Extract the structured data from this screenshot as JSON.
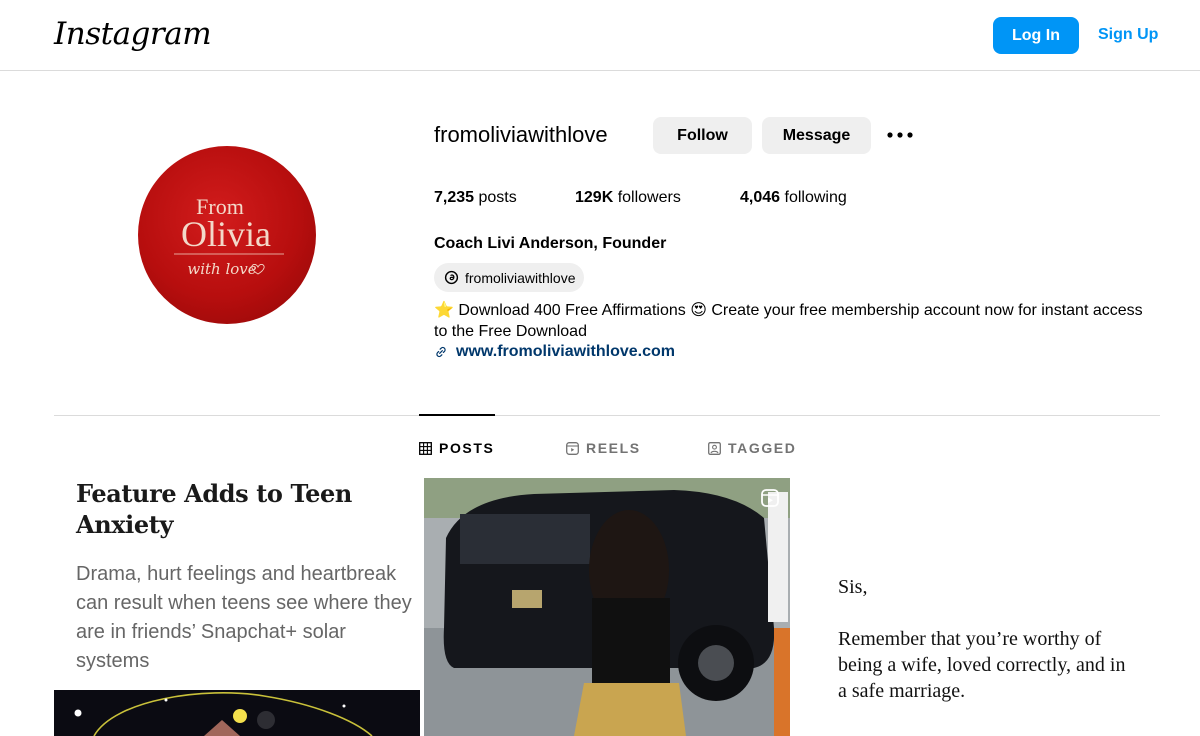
{
  "nav": {
    "logo": "Instagram",
    "login_label": "Log In",
    "signup_label": "Sign Up",
    "accent_color": "#0095f6"
  },
  "profile": {
    "avatar": {
      "line1": "From",
      "line2": "Olivia",
      "line3": "with love",
      "background_color": "#b70e0e"
    },
    "username": "fromoliviawithlove",
    "follow_label": "Follow",
    "message_label": "Message",
    "more_icon": "more-dots-icon",
    "stats": {
      "posts_count": "7,235",
      "posts_label": "posts",
      "followers_count": "129K",
      "followers_label": "followers",
      "following_count": "4,046",
      "following_label": "following"
    },
    "full_name": "Coach Livi Anderson, Founder",
    "threads_handle": "fromoliviawithlove",
    "bio": "⭐ Download 400 Free Affirmations 😍 Create your free membership account now for instant access to the Free Download",
    "website": "www.fromoliviawithlove.com"
  },
  "tabs": [
    {
      "label": "POSTS",
      "icon": "grid-icon",
      "active": true
    },
    {
      "label": "REELS",
      "icon": "reels-icon",
      "active": false
    },
    {
      "label": "TAGGED",
      "icon": "tagged-icon",
      "active": false
    }
  ],
  "posts": [
    {
      "title": "Feature Adds to Teen Anxiety",
      "body": "Drama, hurt feelings and heartbreak can result when teens see where they are in friends’ Snapchat+ solar systems"
    },
    {
      "type": "reel",
      "icon": "reel-icon"
    },
    {
      "greeting": "Sis,",
      "message": "Remember that you’re worthy of being a wife, loved correctly, and in a safe marriage."
    }
  ]
}
